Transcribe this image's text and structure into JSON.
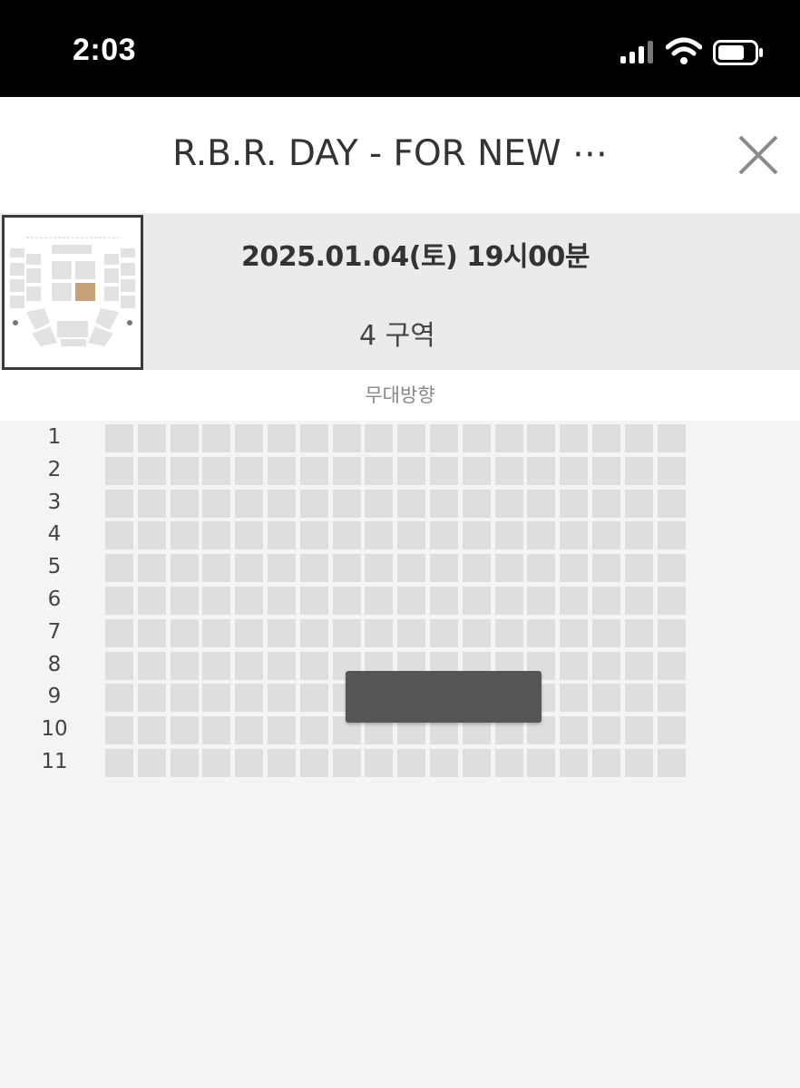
{
  "status_bar": {
    "time": "2:03"
  },
  "header": {
    "title": "R.B.R. DAY - FOR NEW ⋯"
  },
  "info": {
    "datetime": "2025.01.04(토) 19시00분",
    "section": "4 구역"
  },
  "stage_direction": "무대방향",
  "icons": {
    "signal": "cellular-signal-icon",
    "wifi": "wifi-icon",
    "battery": "battery-icon",
    "close": "close-icon"
  },
  "colors": {
    "seat": "#dedede",
    "selected_seat_block": "#545557",
    "highlight_section": "#c9a27a"
  },
  "seat_map": {
    "rows": [
      "1",
      "2",
      "3",
      "4",
      "5",
      "6",
      "7",
      "8",
      "9",
      "10",
      "11"
    ],
    "seats_per_row": 18
  }
}
